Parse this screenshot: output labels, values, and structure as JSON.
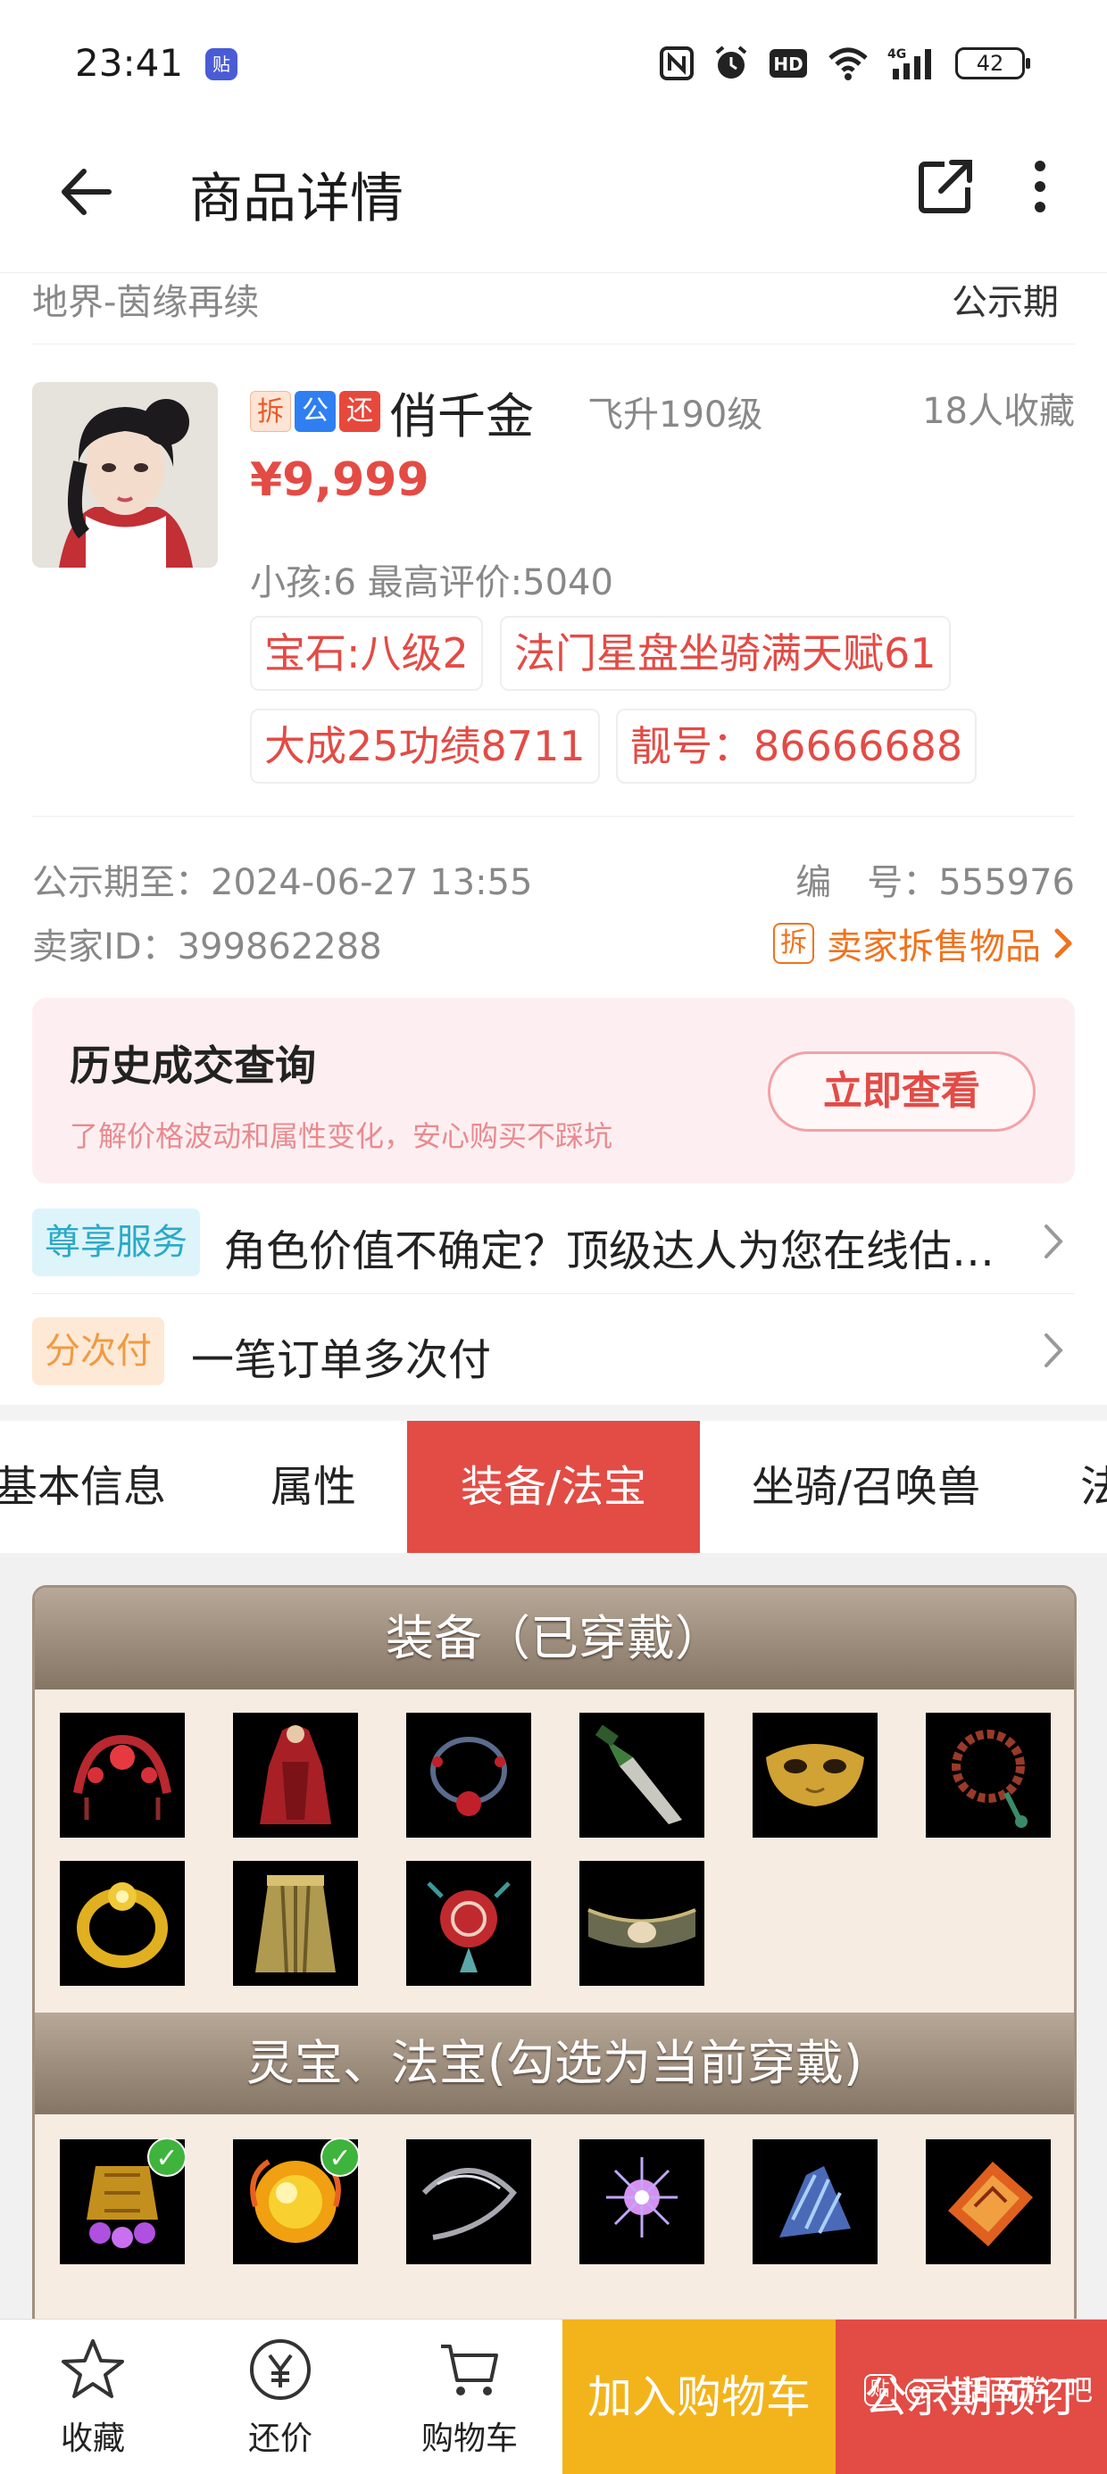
{
  "status_bar": {
    "time": "23:41",
    "app_badge": "贴",
    "battery": "42",
    "icons": [
      "nfc-icon",
      "alarm-icon",
      "hd-icon",
      "wifi-icon",
      "4g-signal-icon",
      "battery-icon"
    ]
  },
  "header": {
    "title": "商品详情"
  },
  "sub_header": {
    "server": "地界-茵缘再续",
    "status": "公示期"
  },
  "product": {
    "tags": [
      "拆",
      "公",
      "还"
    ],
    "name": "俏千金",
    "level": "飞升190级",
    "favorites": "18人收藏",
    "price": "¥9,999",
    "kids_rating": "小孩:6 最高评价:5040",
    "chips": [
      "宝石:八级2",
      "法门星盘坐骑满天赋61",
      "大成25功绩8711",
      "靓号：86666688"
    ]
  },
  "meta": {
    "publicity_end": "公示期至：2024-06-27 13:55",
    "serial": "编　号：555976",
    "seller_id": "卖家ID：399862288",
    "seller_items_icon_text": "拆",
    "seller_items_link": "卖家拆售物品"
  },
  "history": {
    "title": "历史成交查询",
    "subtitle": "了解价格波动和属性变化，安心购买不踩坑",
    "button": "立即查看"
  },
  "services": [
    {
      "badge": "尊享服务",
      "text": "角色价值不确定？顶级达人为您在线估…"
    },
    {
      "badge": "分次付",
      "text": "一笔订单多次付"
    }
  ],
  "tabs": [
    {
      "label": "基本信息",
      "active": false
    },
    {
      "label": "属性",
      "active": false
    },
    {
      "label": "装备/法宝",
      "active": true
    },
    {
      "label": "坐骑/召唤兽",
      "active": false
    },
    {
      "label": "法",
      "active": false
    }
  ],
  "panel": {
    "equipped_title": "装备（已穿戴）",
    "treasure_title": "灵宝、法宝(勾选为当前穿戴)",
    "check_mark": "✓"
  },
  "bottom_bar": {
    "favorite": "收藏",
    "bargain": "还价",
    "cart": "购物车",
    "add_to_cart": "加入购物车",
    "preorder": "公示期预订",
    "watermark": "@大话西游2吧",
    "watermark_logo": "贴"
  },
  "colors": {
    "accent_red": "#e34b45",
    "accent_orange": "#f0731e",
    "cart_yellow": "#f3b41b"
  }
}
